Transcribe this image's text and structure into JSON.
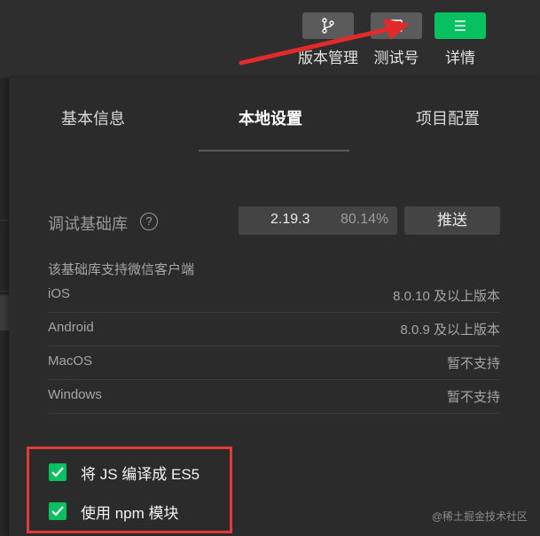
{
  "toolbar": {
    "version_label": "版本管理",
    "test_label": "测试号",
    "detail_label": "详情"
  },
  "tabs": [
    {
      "label": "基本信息",
      "active": false
    },
    {
      "label": "本地设置",
      "active": true
    },
    {
      "label": "项目配置",
      "active": false
    }
  ],
  "debug_lib": {
    "label": "调试基础库",
    "help": "?",
    "version": "2.19.3",
    "percent": "80.14%",
    "push_label": "推送"
  },
  "support": {
    "title": "该基础库支持微信客户端",
    "rows": [
      {
        "os": "iOS",
        "version": "8.0.10 及以上版本"
      },
      {
        "os": "Android",
        "version": "8.0.9 及以上版本"
      },
      {
        "os": "MacOS",
        "version": "暂不支持"
      },
      {
        "os": "Windows",
        "version": "暂不支持"
      }
    ]
  },
  "options": [
    {
      "label": "将 JS 编译成 ES5",
      "checked": true
    },
    {
      "label": "使用 npm 模块",
      "checked": true
    }
  ],
  "watermark": "@稀土掘金技术社区",
  "colors": {
    "accent": "#07c160",
    "highlight_box": "#e23b3b",
    "arrow": "#e32a2a",
    "background": "#2e2e2e"
  }
}
